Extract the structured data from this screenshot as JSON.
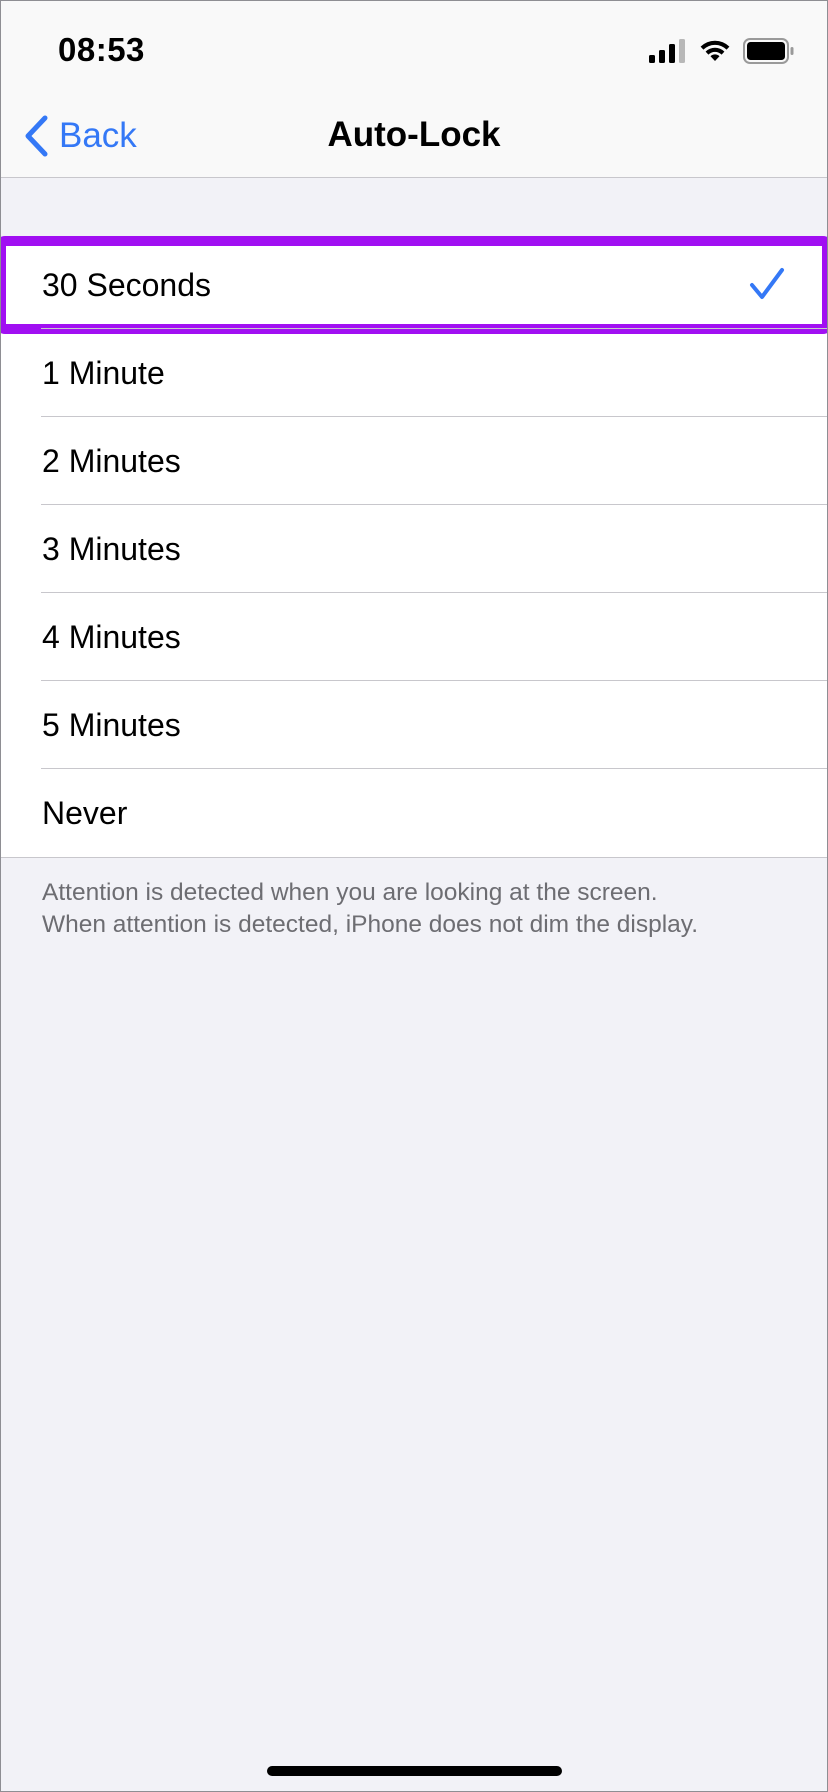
{
  "status_bar": {
    "time": "08:53",
    "icons": [
      "cellular-signal-icon",
      "wifi-icon",
      "battery-icon"
    ]
  },
  "nav": {
    "back_label": "Back",
    "title": "Auto-Lock",
    "back_icon": "chevron-left-icon"
  },
  "options": [
    {
      "label": "30 Seconds",
      "selected": true
    },
    {
      "label": "1 Minute",
      "selected": false
    },
    {
      "label": "2 Minutes",
      "selected": false
    },
    {
      "label": "3 Minutes",
      "selected": false
    },
    {
      "label": "4 Minutes",
      "selected": false
    },
    {
      "label": "5 Minutes",
      "selected": false
    },
    {
      "label": "Never",
      "selected": false
    }
  ],
  "footer": {
    "line1": "Attention is detected when you are looking at the screen.",
    "line2": "When attention is detected, iPhone does not dim the display."
  },
  "colors": {
    "accent": "#3478F6",
    "highlight": "#A10FF2",
    "background": "#F2F2F7"
  }
}
